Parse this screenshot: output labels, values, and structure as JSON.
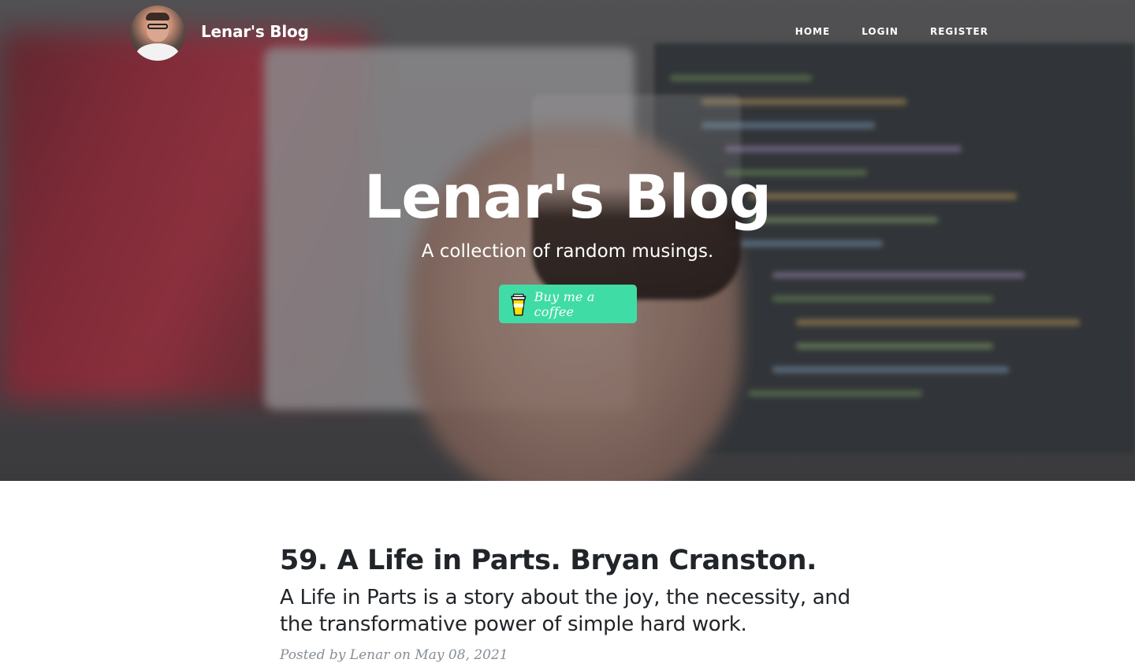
{
  "nav": {
    "brand": "Lenar's Blog",
    "links": [
      "HOME",
      "LOGIN",
      "REGISTER"
    ]
  },
  "hero": {
    "title": "Lenar's Blog",
    "subtitle": "A collection of random musings.",
    "coffee_button": "Buy me a coffee"
  },
  "post": {
    "title": "59. A Life in Parts. Bryan Cranston.",
    "subtitle": "A Life in Parts is a story about the joy, the necessity, and the transformative power of simple hard work.",
    "meta_prefix": "Posted by",
    "author": "Lenar",
    "meta_on": "on",
    "date": "May 08, 2021"
  },
  "colors": {
    "coffee_button": "#40dca5",
    "post_text": "#212529",
    "meta_text": "#868e96"
  },
  "icons": {
    "avatar": "author-avatar",
    "coffee": "coffee-cup-icon"
  }
}
